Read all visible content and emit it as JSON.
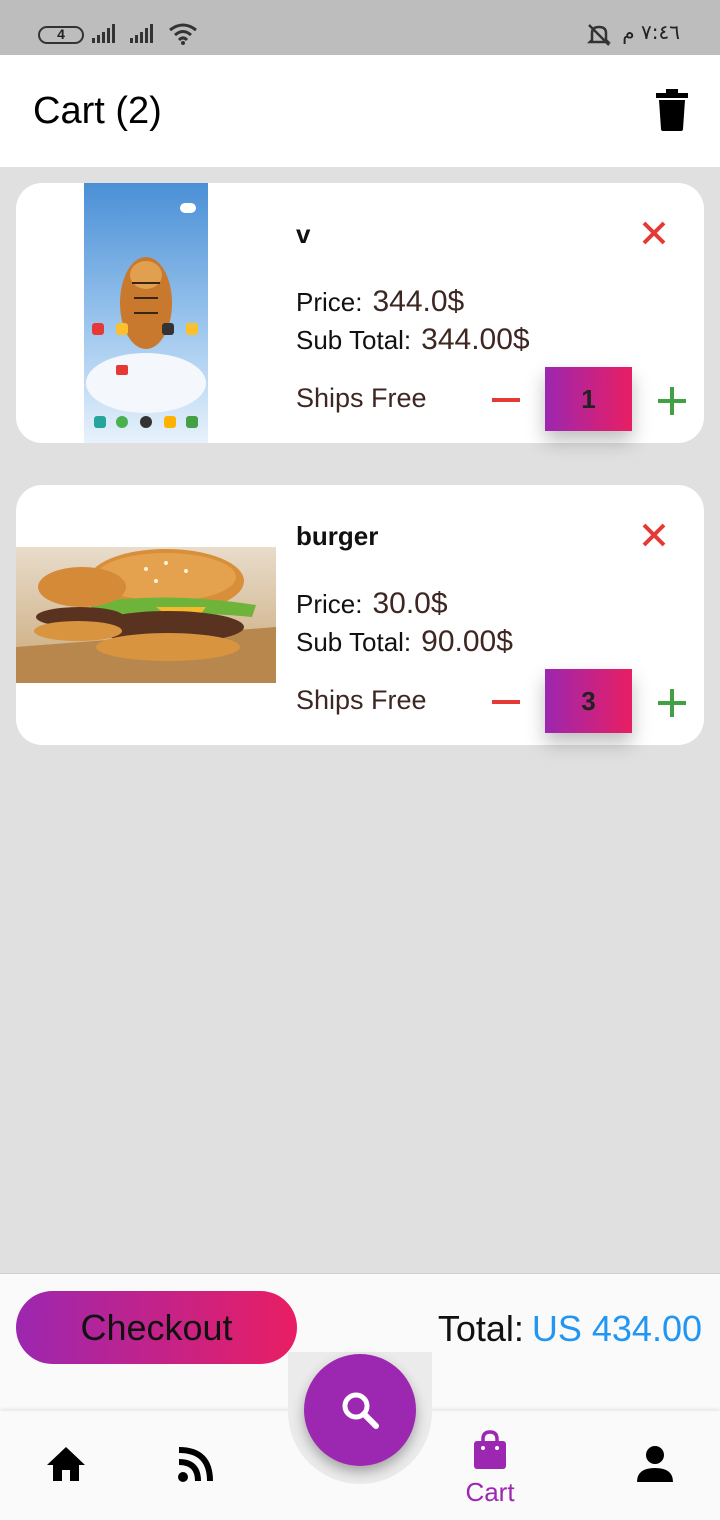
{
  "status_bar": {
    "battery": "4",
    "time": "٧:٤٦ م"
  },
  "header": {
    "title": "Cart (2)"
  },
  "cart": {
    "items": [
      {
        "name": "v",
        "price_label": "Price:",
        "price": "344.0$",
        "subtotal_label": "Sub Total:",
        "subtotal": "344.00$",
        "shipping": "Ships Free",
        "quantity": "1"
      },
      {
        "name": "burger",
        "price_label": "Price:",
        "price": "30.0$",
        "subtotal_label": "Sub Total:",
        "subtotal": "90.00$",
        "shipping": "Ships Free",
        "quantity": "3"
      }
    ]
  },
  "checkout": {
    "button_label": "Checkout",
    "total_label": "Total:",
    "total_value": "US 434.00"
  },
  "bottom_nav": {
    "items": [
      {
        "icon": "home-icon"
      },
      {
        "icon": "rss-feed-icon"
      },
      {
        "icon": "shopping-bag-icon",
        "label": "Cart"
      },
      {
        "icon": "person-icon"
      }
    ],
    "fab_icon": "search-icon"
  },
  "colors": {
    "accent": "#9c27b0",
    "gradient_end": "#e91e63",
    "total_value": "#2196f3",
    "remove": "#e53935",
    "minus": "#e53935",
    "plus": "#43a047"
  }
}
